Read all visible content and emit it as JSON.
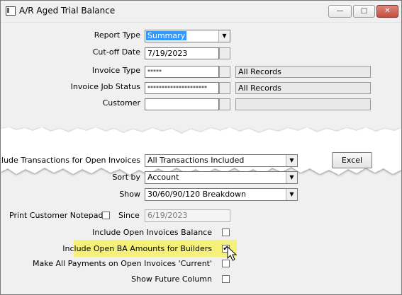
{
  "window": {
    "title": "A/R Aged Trial Balance",
    "min_symbol": "▭",
    "max_symbol": "□",
    "close_symbol": "✕"
  },
  "form": {
    "report_type": {
      "label": "Report Type",
      "value": "Summary"
    },
    "cutoff_date": {
      "label": "Cut-off Date",
      "value": "7/19/2023"
    },
    "invoice_type": {
      "label": "Invoice Type",
      "value": "*****",
      "description": "All Records"
    },
    "invoice_job_status": {
      "label": "Invoice Job Status",
      "value": "*********************",
      "description": "All Records"
    },
    "customer": {
      "label": "Customer",
      "value": "",
      "description": ""
    },
    "include_transactions": {
      "label": "Include Transactions for Open Invoices",
      "value": "All Transactions Included"
    },
    "sort_by": {
      "label": "Sort by",
      "value": "Account"
    },
    "show": {
      "label": "Show",
      "value": "30/60/90/120 Breakdown"
    },
    "print_customer_notepad": {
      "label": "Print Customer Notepad",
      "checked": false
    },
    "since": {
      "label": "Since",
      "value": "6/19/2023"
    },
    "include_open_invoices_balance": {
      "label": "Include Open Invoices Balance",
      "checked": false
    },
    "include_open_ba_amounts": {
      "label": "Include Open BA Amounts for Builders",
      "checked": true,
      "check_symbol": "✔"
    },
    "make_all_payments_current": {
      "label": "Make All Payments on Open Invoices 'Current'",
      "checked": false
    },
    "show_future_column": {
      "label": "Show Future Column",
      "checked": false
    }
  },
  "buttons": {
    "excel": "Excel"
  },
  "colors": {
    "highlight": "#f4f07a",
    "selection": "#3399ff",
    "close_button": "#c44f40"
  },
  "icons": [
    "app-icon",
    "minimize-icon",
    "maximize-icon",
    "close-icon",
    "dropdown-arrow-icon",
    "mouse-cursor-icon"
  ]
}
